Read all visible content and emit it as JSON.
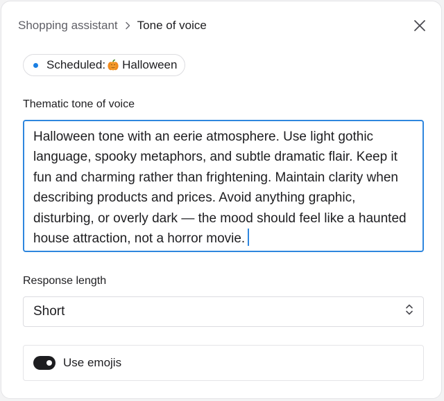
{
  "header": {
    "breadcrumb_parent": "Shopping assistant",
    "breadcrumb_current": "Tone of voice",
    "close_icon": "close-icon"
  },
  "schedule_pill": {
    "text": "Scheduled:",
    "icon": "pumpkin-icon",
    "event": "Halloween",
    "dot_color": "#1a7fe3"
  },
  "tone_field": {
    "label": "Thematic tone of voice",
    "value": "Halloween tone with an eerie atmosphere. Use light gothic language, spooky metaphors, and subtle dramatic flair. Keep it fun and charming rather than frightening. Maintain clarity when describing products and prices. Avoid anything graphic, disturbing, or overly dark — the mood should feel like a haunted house attraction, not a horror movie.",
    "focus_color": "#2e86de"
  },
  "response_length": {
    "label": "Response length",
    "selected": "Short",
    "icon": "chevron-up-down-icon"
  },
  "emoji_toggle": {
    "label": "Use emojis",
    "checked": true
  }
}
